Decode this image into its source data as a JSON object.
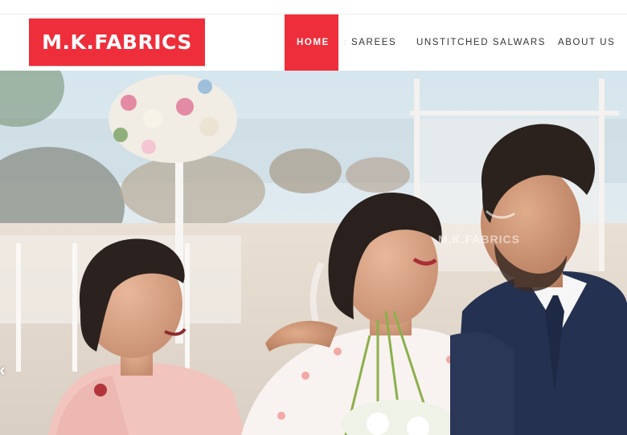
{
  "brand": {
    "logo_text": "M.K.FABRICS",
    "accent": "#ee2e3a"
  },
  "nav": {
    "items": [
      {
        "label": "HOME",
        "active": true
      },
      {
        "label": "SAREES"
      },
      {
        "label": "UNSTITCHED SALWARS"
      },
      {
        "label": "ABOUT US"
      }
    ]
  },
  "hero": {
    "watermark": "M.K.FABRICS",
    "prev_icon": "chevron-left-icon"
  }
}
